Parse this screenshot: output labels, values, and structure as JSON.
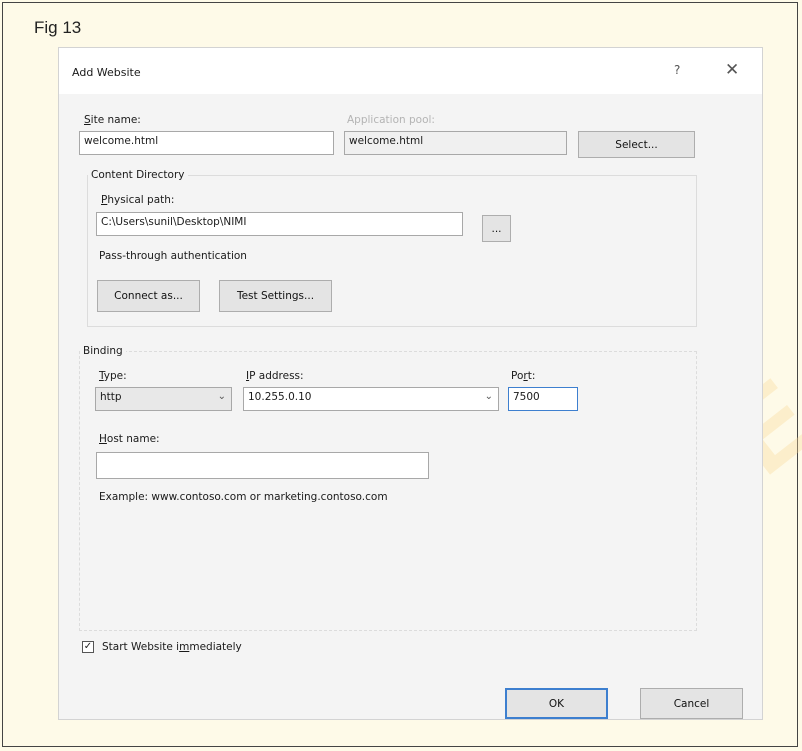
{
  "figure": {
    "label": "Fig 13"
  },
  "watermark": {
    "text": "BLISHE"
  },
  "dialog": {
    "title": "Add Website",
    "help": "?",
    "close": "✕",
    "site_name": {
      "label_key": "S",
      "label_rest": "ite name:",
      "value": "welcome.html"
    },
    "app_pool": {
      "label": "Application pool:",
      "value": "welcome.html"
    },
    "select_button": "Select...",
    "content_directory": {
      "title": "Content Directory",
      "physical_path": {
        "label_key": "P",
        "label_rest": "hysical path:",
        "value": "C:\\Users\\sunil\\Desktop\\NIMI"
      },
      "browse_button": "...",
      "passthrough_label": "Pass-through authentication",
      "connect_as_button": "Connect as...",
      "test_settings_button": "Test Settings..."
    },
    "binding": {
      "title": "Binding",
      "type": {
        "label_key": "T",
        "label_rest": "ype:",
        "value": "http"
      },
      "ip": {
        "label_key": "I",
        "label_rest": "P address:",
        "value": "10.255.0.10"
      },
      "port": {
        "label_pre": "Po",
        "label_key": "r",
        "label_rest": "t:",
        "value": "7500"
      },
      "host": {
        "label_key": "H",
        "label_rest": "ost name:",
        "value": ""
      },
      "example": "Example: www.contoso.com or marketing.contoso.com"
    },
    "start_immediately": {
      "label_pre": "Start Website i",
      "label_key": "m",
      "label_rest": "mediately",
      "checked": true,
      "mark": "✓"
    },
    "ok_button": "OK",
    "cancel_button": "Cancel"
  }
}
